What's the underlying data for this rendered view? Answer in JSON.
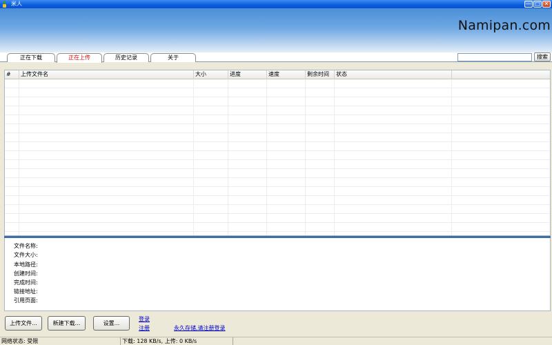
{
  "window": {
    "title": "米人",
    "min_glyph": "—",
    "max_glyph": "□",
    "close_glyph": "✕"
  },
  "banner": {
    "brand": "Namipan.com"
  },
  "tabs": [
    {
      "label": "正在下载",
      "active": false
    },
    {
      "label": "正在上传",
      "active": true
    },
    {
      "label": "历史记录",
      "active": false
    },
    {
      "label": "关于",
      "active": false
    }
  ],
  "search": {
    "value": "",
    "button": "搜索"
  },
  "list": {
    "columns": [
      "#",
      "上传文件名",
      "大小",
      "进度",
      "速度",
      "剩余时间",
      "状态"
    ]
  },
  "details": {
    "labels": [
      "文件名称:",
      "文件大小:",
      "本地路径:",
      "创建时间:",
      "完成时间:",
      "链接地址:",
      "引用页面:"
    ]
  },
  "buttons": {
    "upload": "上传文件...",
    "new_download": "新建下载...",
    "settings": "设置..."
  },
  "links": {
    "login": "登录",
    "register": "注册",
    "permanent": "永久存储,请注册登录"
  },
  "status": {
    "network": "网络状态: 受限",
    "speed": "下载: 128 KB/s, 上传: 0 KB/s",
    "extra": ""
  },
  "icons": {
    "app": "person-icon",
    "minimize": "minimize-icon",
    "maximize": "maximize-icon",
    "close": "close-icon"
  }
}
